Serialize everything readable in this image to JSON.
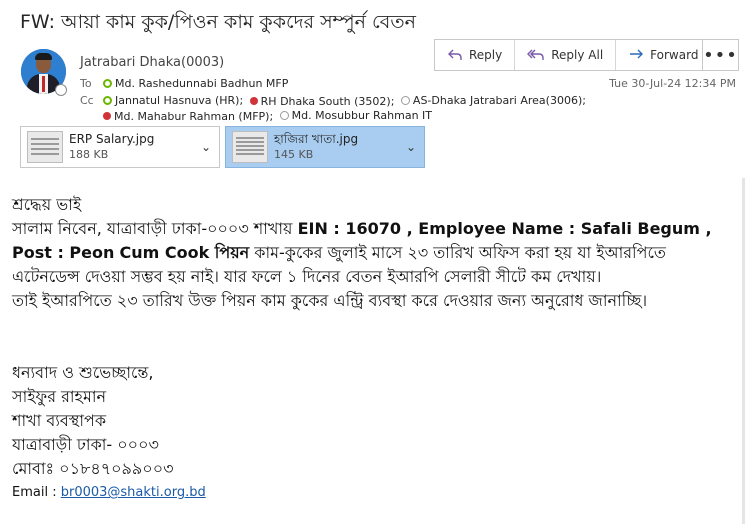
{
  "subject": "FW: আয়া কাম কুক/পিওন কাম কুকদের  সম্পুর্ন বেতন",
  "sender": "Jatrabari Dhaka(0003)",
  "to_label": "To",
  "cc_label": "Cc",
  "to": [
    {
      "name": "Md. Rashedunnabi Badhun MFP",
      "status": "green"
    }
  ],
  "cc_line1": [
    {
      "name": "Jannatul Hasnuva (HR);",
      "status": "green"
    },
    {
      "name": "RH Dhaka South (3502);",
      "status": "red"
    },
    {
      "name": "AS-Dhaka Jatrabari Area(3006);",
      "status": "gray"
    }
  ],
  "cc_line2": [
    {
      "name": "Md. Mahabur Rahman (MFP);",
      "status": "red"
    },
    {
      "name": "Md. Mosubbur Rahman IT",
      "status": "gray"
    }
  ],
  "datetime": "Tue 30-Jul-24 12:34 PM",
  "actions": {
    "reply": "Reply",
    "reply_all": "Reply All",
    "forward": "Forward",
    "more": "•••"
  },
  "attachments": [
    {
      "name": "ERP Salary.jpg",
      "size": "188 KB",
      "selected": false
    },
    {
      "name": "হাজিরা খাতা.jpg",
      "size": "145 KB",
      "selected": true
    }
  ],
  "body": {
    "greeting": "শ্রদ্ধেয় ভাই",
    "line_intro": "সালাম নিবেন, যাত্রাবাড়ী ঢাকা-০০০৩ শাখায় ",
    "line_details": "EIN : 16070 , Employee Name : Safali Begum , Post : Peon",
    "line2_bold": "Cum Cook পিয়ন",
    "line2_rest": " কাম-কুকের জুলাই মাসে ২৩ তারিখ অফিস করা হয় যা ইআরপিতে এটেনডেন্স দেওয়া সম্ভব হয় নাই। যার ফলে ১ দিনের বেতন ইআরপি সেলারী সীটে কম দেখায়।",
    "paragraph2": "তাই ইআরপিতে ২৩ তারিখ উক্ত পিয়ন কাম কুকের এন্ট্রি ব্যবস্থা করে দেওয়ার জন্য অনুরোধ জানাচ্ছি।",
    "closing": "ধন্যবাদ ও শুভেচ্ছান্তে,",
    "name": "সাইফুর রাহমান",
    "designation": "শাখা ব্যবস্থাপক",
    "branch": "যাত্রাবাড়ী ঢাকা- ০০০৩",
    "mobile": "মোবাঃ ০১৮৪৭০৯৯০০৩",
    "email_label": "Email : ",
    "email": "br0003@shakti.org.bd"
  }
}
